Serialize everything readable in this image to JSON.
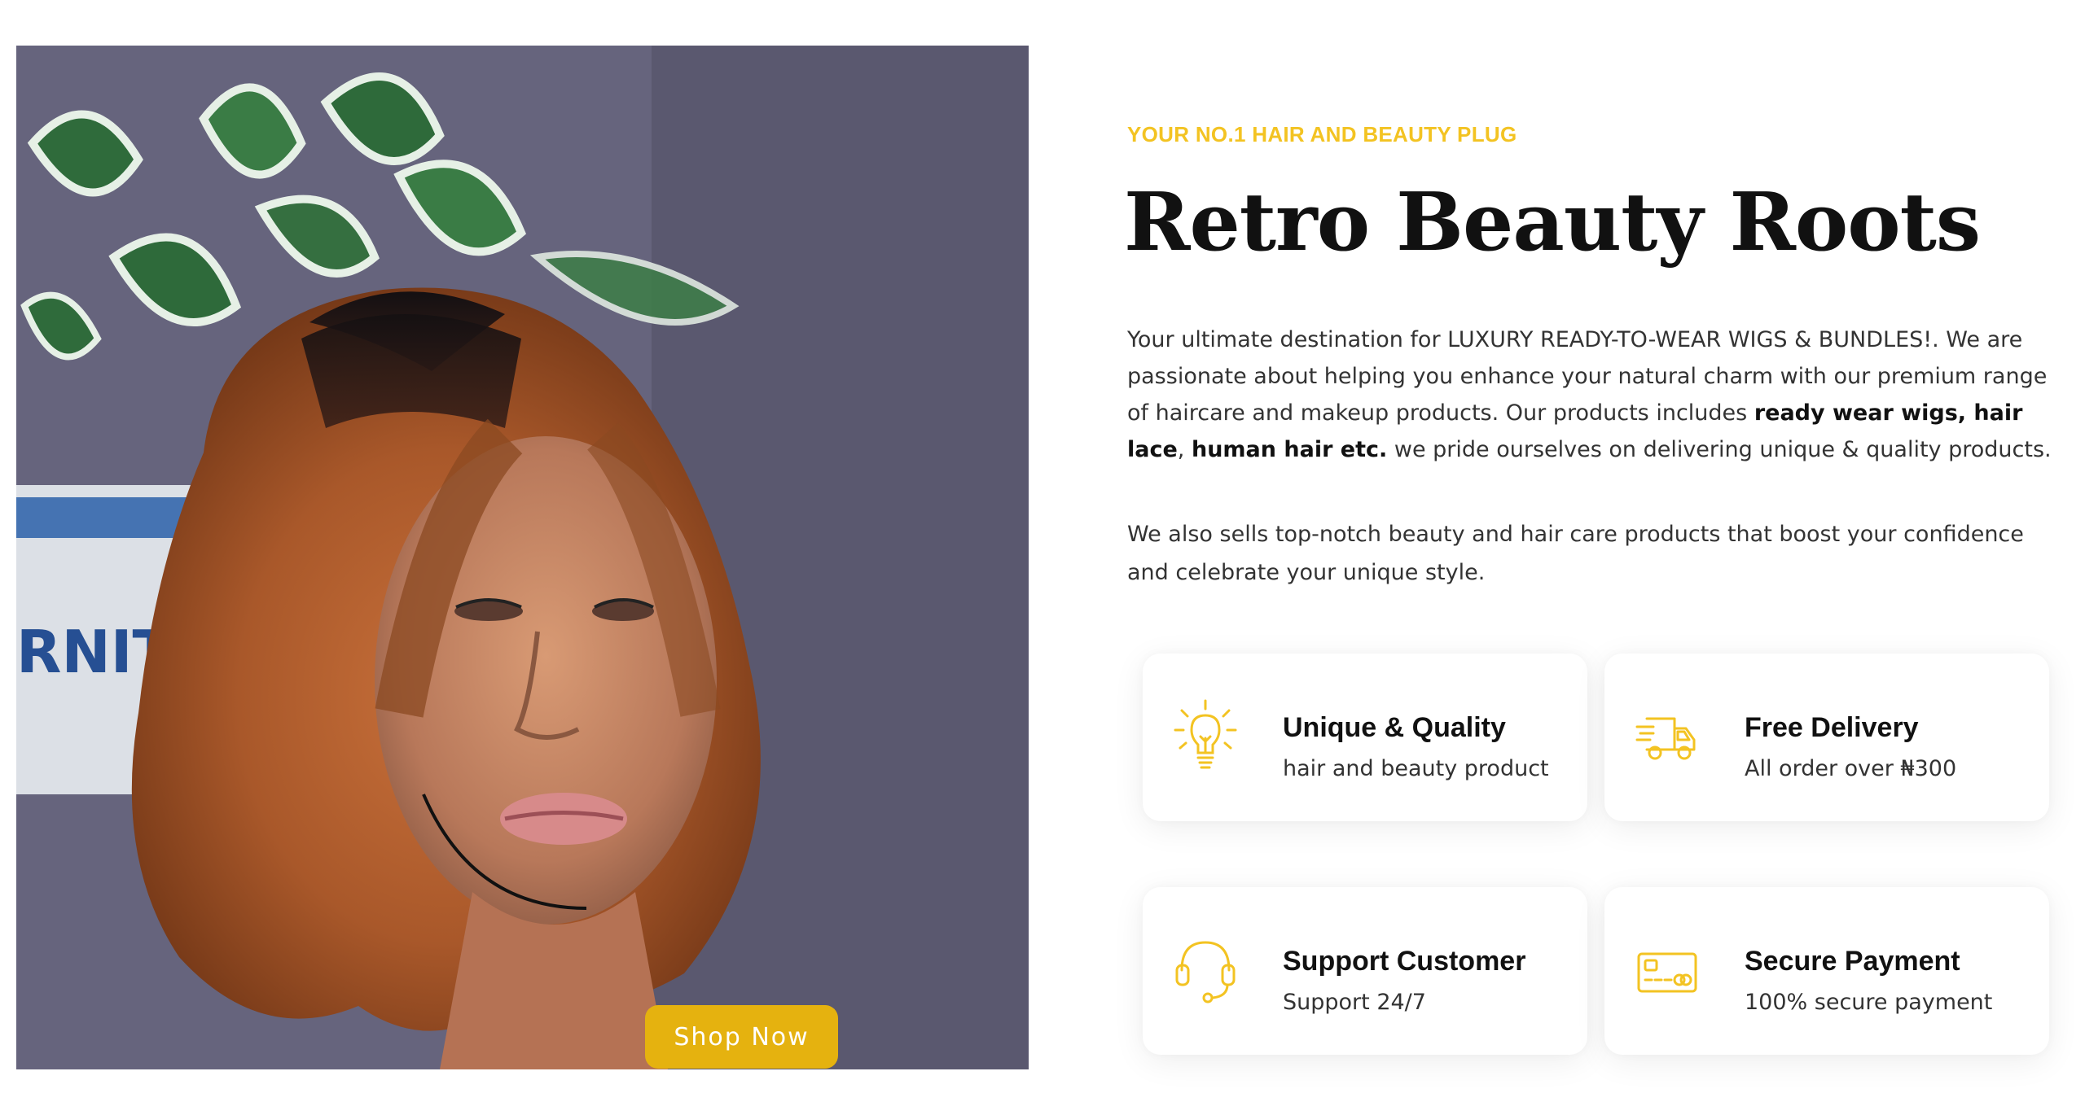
{
  "hero": {
    "shop_now_label": "Shop Now",
    "backdrop_text": "RNITA"
  },
  "about": {
    "eyebrow": "YOUR NO.1 HAIR AND BEAUTY PLUG",
    "title": "Retro Beauty Roots",
    "intro_part1": "Your ultimate destination for LUXURY READY-TO-WEAR WIGS & BUNDLES!. We are passionate about helping you enhance your natural charm with our premium range of haircare and makeup products. Our products includes ",
    "intro_bold1": "ready wear wigs, hair lace",
    "intro_part2": ", ",
    "intro_bold2": "human hair etc.",
    "intro_part3": " we pride ourselves on delivering unique & quality products.",
    "intro_2": "We also sells top-notch beauty and hair care products that boost your confidence and celebrate your unique style."
  },
  "features": [
    {
      "icon": "lightbulb-icon",
      "title": "Unique & Quality",
      "subtitle": "hair and beauty product"
    },
    {
      "icon": "delivery-truck-icon",
      "title": "Free Delivery",
      "subtitle": "All order over ₦300"
    },
    {
      "icon": "headset-icon",
      "title": "Support Customer",
      "subtitle": "Support 24/7"
    },
    {
      "icon": "credit-card-icon",
      "title": "Secure Payment",
      "subtitle": "100% secure payment"
    }
  ],
  "colors": {
    "accent": "#f3c322",
    "button": "#e5b20f",
    "title": "#111111",
    "body_text": "#333333"
  }
}
